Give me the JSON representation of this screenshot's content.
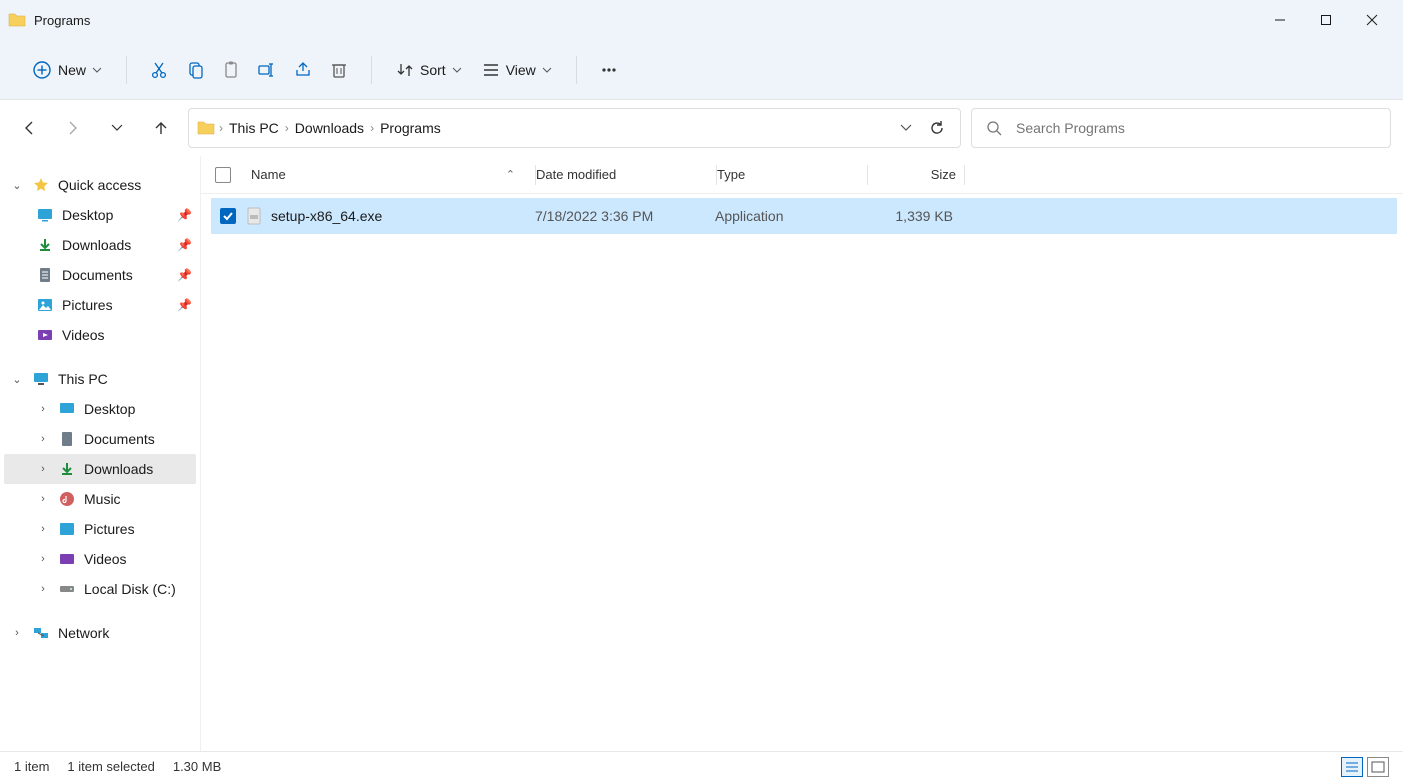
{
  "window": {
    "title": "Programs"
  },
  "toolbar": {
    "new_label": "New",
    "sort_label": "Sort",
    "view_label": "View"
  },
  "breadcrumb": {
    "items": [
      "This PC",
      "Downloads",
      "Programs"
    ]
  },
  "search": {
    "placeholder": "Search Programs"
  },
  "sidebar": {
    "quick_access": "Quick access",
    "qa_items": [
      {
        "label": "Desktop",
        "pinned": true
      },
      {
        "label": "Downloads",
        "pinned": true
      },
      {
        "label": "Documents",
        "pinned": true
      },
      {
        "label": "Pictures",
        "pinned": true
      },
      {
        "label": "Videos",
        "pinned": false
      }
    ],
    "this_pc": "This PC",
    "pc_items": [
      {
        "label": "Desktop"
      },
      {
        "label": "Documents"
      },
      {
        "label": "Downloads",
        "selected": true
      },
      {
        "label": "Music"
      },
      {
        "label": "Pictures"
      },
      {
        "label": "Videos"
      },
      {
        "label": "Local Disk (C:)"
      }
    ],
    "network": "Network"
  },
  "columns": {
    "name": "Name",
    "date": "Date modified",
    "type": "Type",
    "size": "Size"
  },
  "files": [
    {
      "name": "setup-x86_64.exe",
      "date": "7/18/2022 3:36 PM",
      "type": "Application",
      "size": "1,339 KB",
      "selected": true
    }
  ],
  "status": {
    "count": "1 item",
    "selected": "1 item selected",
    "size": "1.30 MB"
  }
}
